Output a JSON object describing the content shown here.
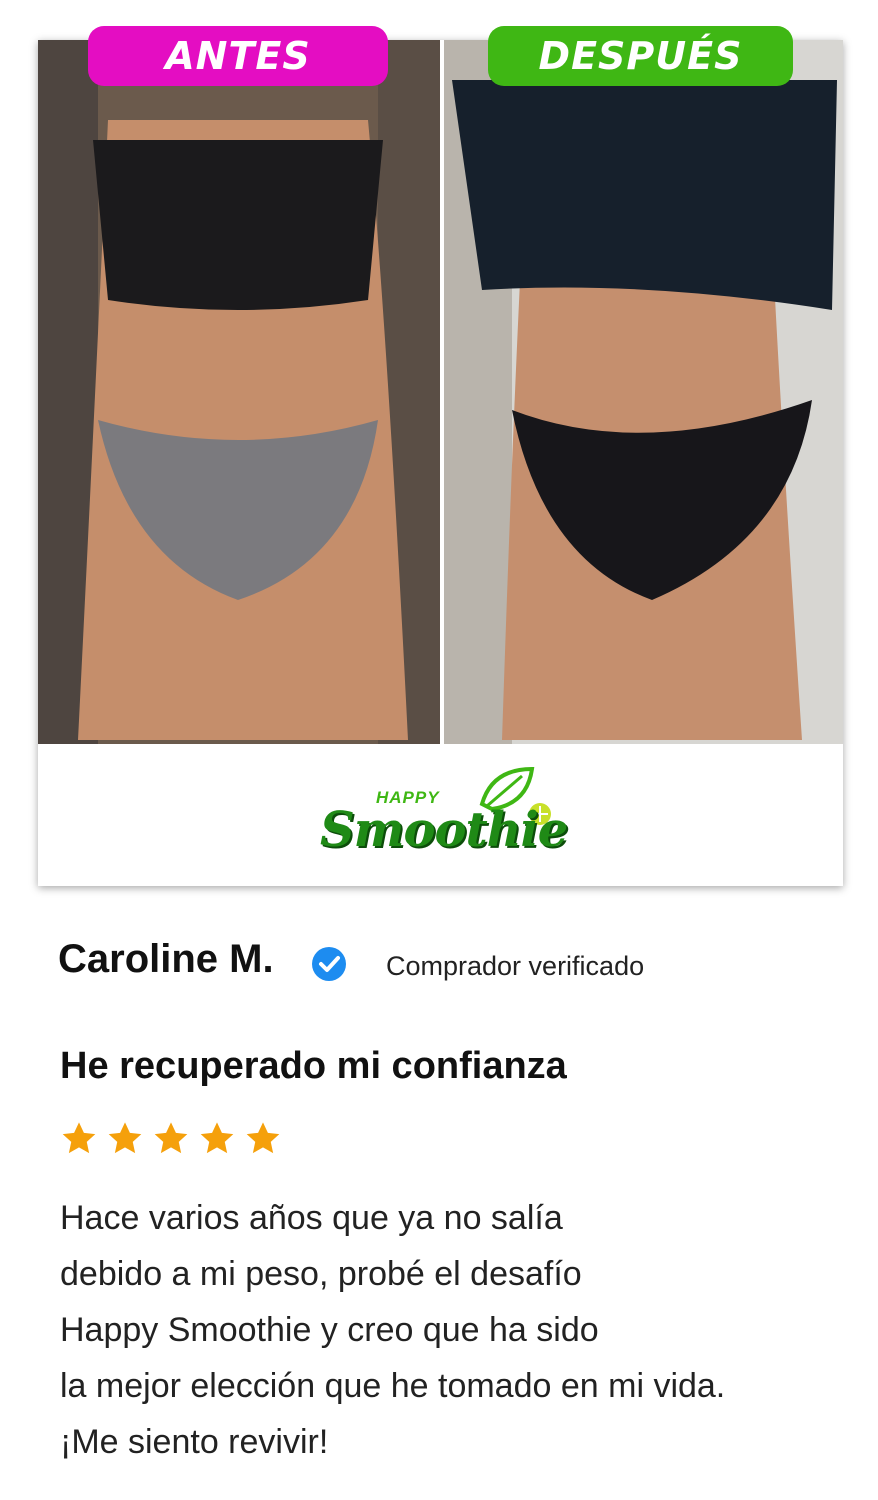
{
  "badges": {
    "before": "ANTES",
    "after": "DESPUÉS"
  },
  "logo": {
    "top": "HAPPY",
    "main": "Smoothie"
  },
  "reviewer": {
    "name": "Caroline M.",
    "verified_label": "Comprador verificado"
  },
  "review": {
    "title": "He recuperado mi confianza",
    "rating": 5,
    "lines": [
      "Hace varios años que ya no salía",
      "debido a mi peso, probé el desafío",
      "Happy Smoothie y creo que ha sido",
      "la mejor elección que he tomado en mi vida.",
      "¡Me siento revivir!"
    ]
  },
  "colors": {
    "before": "#e40dc2",
    "after": "#3fb714",
    "star": "#f5a00b",
    "verified": "#1d8cf0"
  }
}
